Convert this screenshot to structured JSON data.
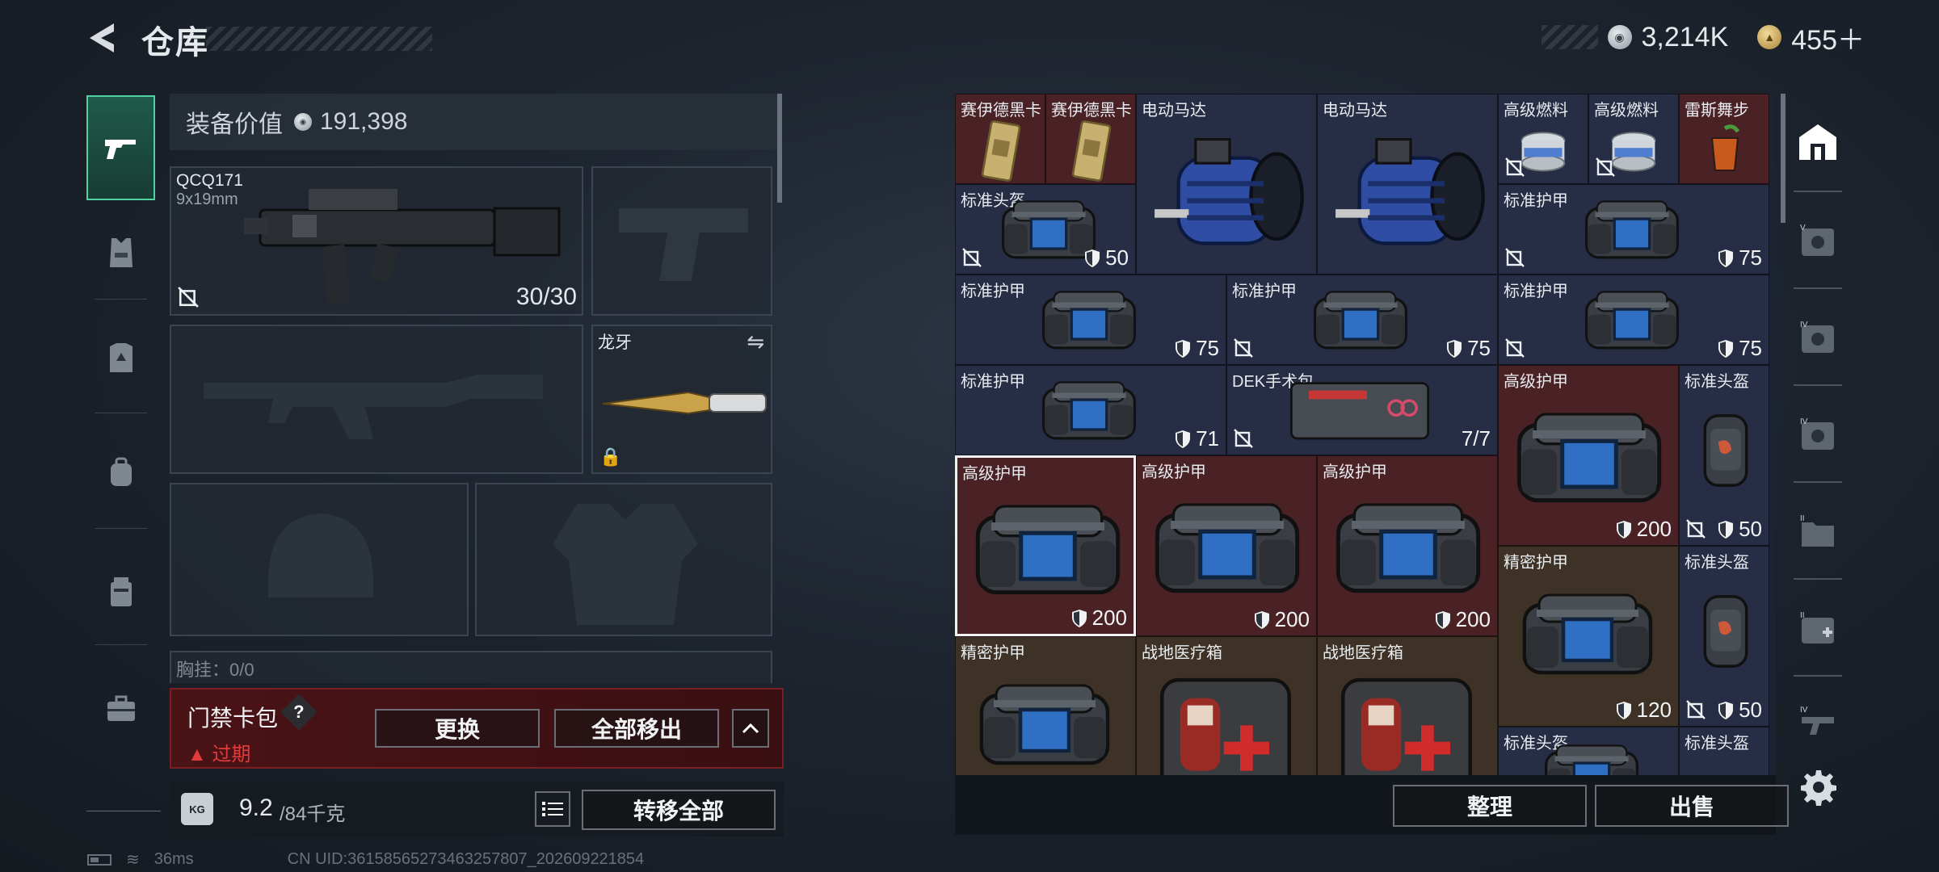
{
  "header": {
    "title": "仓库",
    "currency": [
      {
        "icon": "silver-coin-icon",
        "value": "3,214K"
      },
      {
        "icon": "gold-coin-icon",
        "value": "455＋"
      }
    ]
  },
  "left_rail": {
    "items": [
      {
        "icon": "gun-icon",
        "active": true
      },
      {
        "icon": "armor-vest-icon",
        "active": false
      },
      {
        "icon": "chest-rig-icon",
        "active": false
      },
      {
        "icon": "backpack-icon",
        "active": false
      },
      {
        "icon": "container-icon",
        "active": false
      },
      {
        "icon": "briefcase-icon",
        "active": false
      }
    ]
  },
  "equipment": {
    "value_label": "装备价值",
    "value": "191,398",
    "primary_weapon": {
      "name": "QCQ171",
      "caliber": "9x19mm",
      "ammo": "30/30"
    },
    "melee": {
      "name": "龙牙"
    },
    "chest_rig_label": "胸挂：0/0",
    "keycard": {
      "title": "门禁卡包",
      "help": "?",
      "status": "过期",
      "replace": "更换",
      "move_all": "全部移出"
    },
    "weight": {
      "current": "9.2",
      "capacity": "/84千克"
    },
    "transfer_all": "转移全部"
  },
  "inventory": {
    "sort_button": "整理",
    "sell_button": "出售",
    "items": [
      {
        "name": "赛伊德黑卡",
        "rarity": "red",
        "image": "keycard"
      },
      {
        "name": "赛伊德黑卡",
        "rarity": "red",
        "image": "keycard"
      },
      {
        "name": "电动马达",
        "rarity": "blue",
        "image": "motor"
      },
      {
        "name": "电动马达",
        "rarity": "blue",
        "image": "motor"
      },
      {
        "name": "高级燃料",
        "rarity": "blue",
        "image": "fuel"
      },
      {
        "name": "高级燃料",
        "rarity": "blue",
        "image": "fuel"
      },
      {
        "name": "雷斯舞步",
        "rarity": "red",
        "image": "cocktail"
      },
      {
        "name": "标准头盔",
        "rarity": "blue",
        "value": "50",
        "image": "helmet"
      },
      {
        "name": "标准护甲",
        "rarity": "blue",
        "value": "75",
        "image": "armor"
      },
      {
        "name": "标准护甲",
        "rarity": "blue",
        "value": "75",
        "image": "armor"
      },
      {
        "name": "标准护甲",
        "rarity": "blue",
        "value": "75",
        "image": "armor"
      },
      {
        "name": "标准护甲",
        "rarity": "blue",
        "value": "75",
        "image": "armor"
      },
      {
        "name": "标准护甲",
        "rarity": "blue",
        "value": "71",
        "image": "armor"
      },
      {
        "name": "DEK手术包",
        "rarity": "blue",
        "value": "7/7",
        "image": "surgery-kit"
      },
      {
        "name": "高级护甲",
        "rarity": "red",
        "value": "200",
        "image": "armor"
      },
      {
        "name": "标准头盔",
        "rarity": "blue",
        "value": "50",
        "image": "helmet"
      },
      {
        "name": "高级护甲",
        "rarity": "red",
        "value": "200",
        "image": "armor",
        "selected": true
      },
      {
        "name": "高级护甲",
        "rarity": "red",
        "value": "200",
        "image": "armor"
      },
      {
        "name": "高级护甲",
        "rarity": "red",
        "value": "200",
        "image": "armor"
      },
      {
        "name": "精密护甲",
        "rarity": "gold",
        "value": "120",
        "image": "armor"
      },
      {
        "name": "标准头盔",
        "rarity": "blue",
        "value": "50",
        "image": "helmet"
      },
      {
        "name": "精密护甲",
        "rarity": "gold",
        "image": "armor"
      },
      {
        "name": "战地医疗箱",
        "rarity": "gold",
        "image": "medkit"
      },
      {
        "name": "战地医疗箱",
        "rarity": "gold",
        "image": "medkit"
      },
      {
        "name": "标准头盔",
        "rarity": "blue",
        "image": "helmet"
      },
      {
        "name": "标准头盔",
        "rarity": "blue",
        "image": "helmet"
      }
    ]
  },
  "right_rail": {
    "items": [
      {
        "icon": "home-icon",
        "active": true
      },
      {
        "icon": "tier-v-safe-icon"
      },
      {
        "icon": "tier-iv-safe-icon"
      },
      {
        "icon": "tier-iv-safe-icon"
      },
      {
        "icon": "tier-ii-folder-icon"
      },
      {
        "icon": "tier-ii-medkit-icon"
      },
      {
        "icon": "tier-iv-gun-icon"
      }
    ],
    "settings_icon": "gear-icon"
  },
  "status_bar": {
    "ping": "36ms",
    "uid": "CN UID:36158565273463257807_202609221854"
  },
  "colors": {
    "accent": "#4fd2a2",
    "rarity_red": "#4a2226",
    "rarity_blue": "#262d44",
    "rarity_gold": "#3e3226",
    "warning": "#e23b3b"
  }
}
